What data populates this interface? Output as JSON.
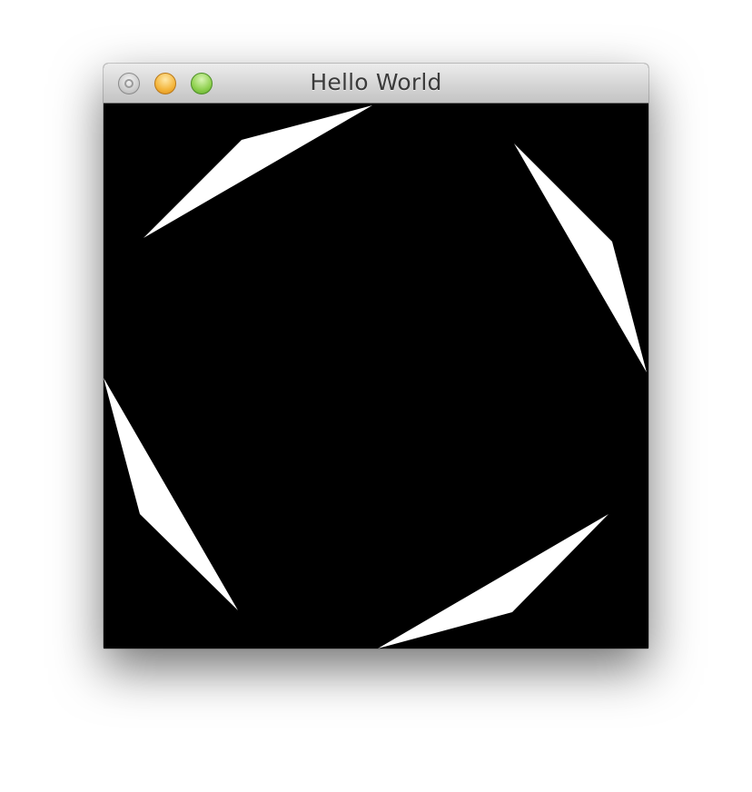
{
  "window": {
    "title": "Hello World",
    "buttons": [
      {
        "name": "close",
        "icon": "close-icon"
      },
      {
        "name": "minimize",
        "icon": "minimize-icon"
      },
      {
        "name": "zoom",
        "icon": "zoom-icon"
      }
    ]
  },
  "canvas": {
    "background": "#000000",
    "shape_color": "#ffffff",
    "shape_count": 4
  }
}
